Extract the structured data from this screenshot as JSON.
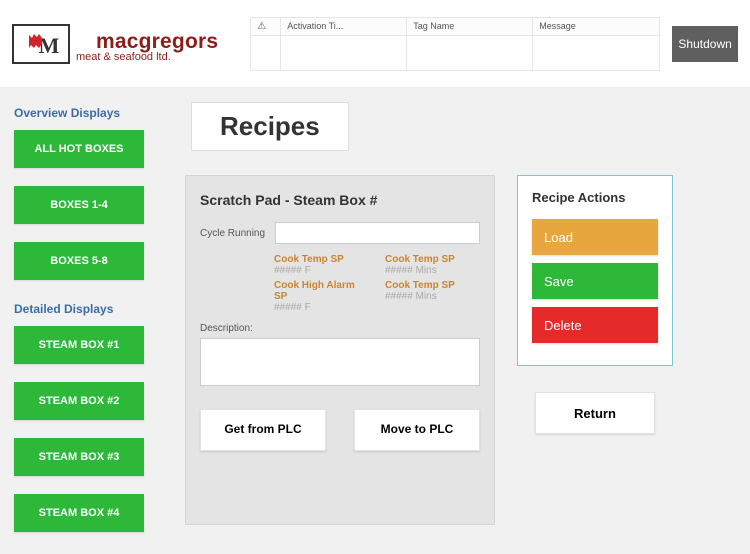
{
  "header": {
    "logo_name": "macgregors",
    "logo_sub": "meat & seafood ltd.",
    "status_cols": [
      "",
      "Activation Ti...",
      "Tag Name",
      "Message"
    ],
    "warn_glyph": "⚠",
    "shutdown_label": "Shutdown"
  },
  "sidebar": {
    "overview_heading": "Overview Displays",
    "overview": [
      "ALL HOT BOXES",
      "BOXES 1-4",
      "BOXES 5-8"
    ],
    "detailed_heading": "Detailed Displays",
    "detailed": [
      "STEAM BOX #1",
      "STEAM BOX #2",
      "STEAM BOX #3",
      "STEAM BOX #4"
    ]
  },
  "main": {
    "page_title": "Recipes",
    "scratch": {
      "title": "Scratch Pad - Steam Box #",
      "cycle_label": "Cycle Running",
      "cycle_value": "",
      "params": [
        {
          "name": "Cook Temp SP",
          "value": "##### F"
        },
        {
          "name": "Cook Temp SP",
          "value": "##### Mins"
        },
        {
          "name": "Cook High Alarm SP",
          "value": "##### F"
        },
        {
          "name": "Cook Temp SP",
          "value": "##### Mins"
        }
      ],
      "desc_label": "Description:",
      "desc_value": "",
      "get_from_plc": "Get from PLC",
      "move_to_plc": "Move to PLC"
    },
    "actions": {
      "title": "Recipe Actions",
      "load": "Load",
      "save": "Save",
      "delete": "Delete"
    },
    "return_label": "Return"
  }
}
